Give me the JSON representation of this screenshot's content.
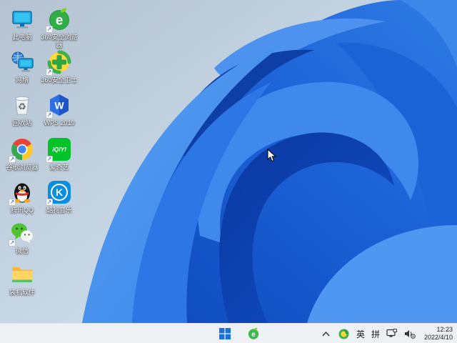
{
  "desktop": {
    "icons": [
      {
        "id": "this-pc",
        "label": "此电脑",
        "col": 1,
        "row": 1,
        "shortcut": false
      },
      {
        "id": "network",
        "label": "网络",
        "col": 1,
        "row": 2,
        "shortcut": false
      },
      {
        "id": "recycle-bin",
        "label": "回收站",
        "col": 1,
        "row": 3,
        "shortcut": false
      },
      {
        "id": "chrome",
        "label": "谷歌浏览器",
        "col": 1,
        "row": 4,
        "shortcut": true
      },
      {
        "id": "qq",
        "label": "腾讯QQ",
        "col": 1,
        "row": 5,
        "shortcut": true
      },
      {
        "id": "wechat",
        "label": "微信",
        "col": 1,
        "row": 6,
        "shortcut": true
      },
      {
        "id": "software-folder",
        "label": "装机软件",
        "col": 1,
        "row": 7,
        "shortcut": false
      },
      {
        "id": "360-browser",
        "label": "360安全浏览器",
        "col": 2,
        "row": 1,
        "shortcut": true,
        "glyph": "e"
      },
      {
        "id": "360-guard",
        "label": "360安全卫士",
        "col": 2,
        "row": 2,
        "shortcut": true
      },
      {
        "id": "wps",
        "label": "WPS 2019",
        "col": 2,
        "row": 3,
        "shortcut": true,
        "glyph": "W"
      },
      {
        "id": "iqiyi",
        "label": "爱奇艺",
        "col": 2,
        "row": 4,
        "shortcut": true,
        "glyph": "iQIYI"
      },
      {
        "id": "kugou",
        "label": "酷狗音乐",
        "col": 2,
        "row": 5,
        "shortcut": true,
        "glyph": "K"
      }
    ]
  },
  "taskbar": {
    "center_icons": [
      "windows-start",
      "360-safe-browser"
    ],
    "tray": {
      "chevron_label": "^",
      "ime_english": "英",
      "ime_pinyin": "拼"
    },
    "clock": {
      "time": "12:23",
      "date": "2022/4/10"
    }
  },
  "colors": {
    "bg_top": "#b6c4d2",
    "bg_bottom": "#dce9f4",
    "bloom_deep": "#0b3ca8",
    "bloom_mid": "#2a72df",
    "bloom_bright": "#4f97f0",
    "taskbar_bg": "#eef1f4",
    "label_text": "#ffffff",
    "win_logo_blue": "#1872d9",
    "browser_green": "#2fae47",
    "guard_yellow": "#ffd83b",
    "iqiyi_green": "#00c32a",
    "kugou_blue": "#0a8fe0",
    "wps_blue": "#2d6fe4"
  }
}
